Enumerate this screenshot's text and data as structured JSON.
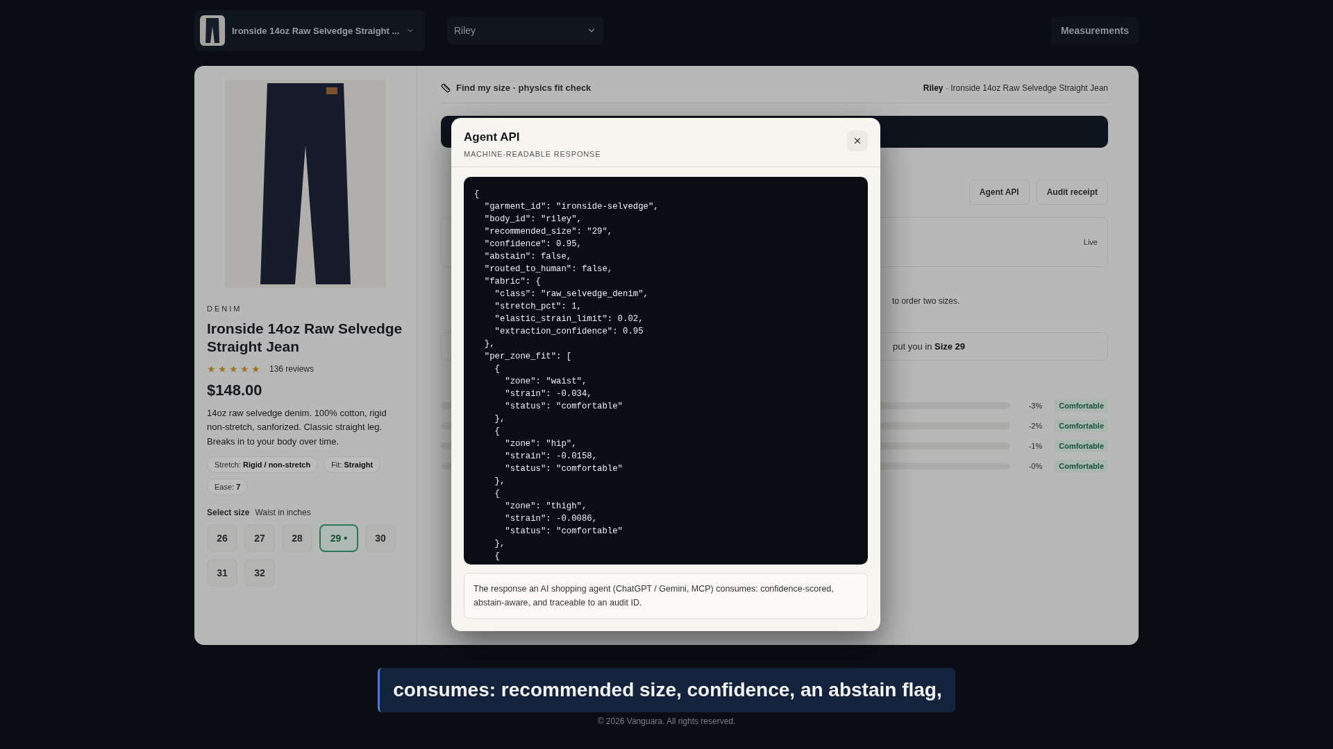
{
  "header": {
    "product_selector": "Ironside 14oz Raw Selvedge Straight ...",
    "body_select": "Riley",
    "measurements_button": "Measurements"
  },
  "product": {
    "category": "DENIM",
    "title": "Ironside 14oz Raw Selvedge Straight Jean",
    "stars": 5,
    "reviews": "136 reviews",
    "price": "$148.00",
    "description": "14oz raw selvedge denim. 100% cotton, rigid non-stretch, sanforized. Classic straight leg. Breaks in to your body over time.",
    "chips": [
      {
        "label": "Stretch:",
        "value": "Rigid / non-stretch"
      },
      {
        "label": "Fit:",
        "value": "Straight"
      },
      {
        "label": "Ease:",
        "value": "7"
      }
    ],
    "size_label": "Select size",
    "size_hint": "Waist in inches",
    "sizes": [
      {
        "label": "26",
        "selected": false
      },
      {
        "label": "27",
        "selected": false
      },
      {
        "label": "28",
        "selected": false
      },
      {
        "label": "29 •",
        "selected": true
      },
      {
        "label": "30",
        "selected": false
      },
      {
        "label": "31",
        "selected": false
      },
      {
        "label": "32",
        "selected": false
      }
    ]
  },
  "fit_panel": {
    "title": "Find my size · physics fit check",
    "breadcrumb": "**Riley** · Ironside 14oz Raw Selvedge Straight Jean",
    "buttons": [
      "Agent API",
      "Audit receipt"
    ],
    "tag": "Live",
    "note_fragment": "to order two sizes.",
    "result_fragment": "put you in **Size 29**",
    "zones": [
      {
        "reading": "-3%",
        "status": "Comfortable"
      },
      {
        "reading": "-2%",
        "status": "Comfortable"
      },
      {
        "reading": "-1%",
        "status": "Comfortable"
      },
      {
        "reading": "-0%",
        "status": "Comfortable"
      }
    ]
  },
  "modal": {
    "title": "Agent API",
    "subtitle": "MACHINE-READABLE RESPONSE",
    "code_lines": [
      "{",
      "  \"garment_id\": \"ironside-selvedge\",",
      "  \"body_id\": \"riley\",",
      "  \"recommended_size\": \"29\",",
      "  \"confidence\": 0.95,",
      "  \"abstain\": false,",
      "  \"routed_to_human\": false,",
      "  \"fabric\": {",
      "    \"class\": \"raw_selvedge_denim\",",
      "    \"stretch_pct\": 1,",
      "    \"elastic_strain_limit\": 0.02,",
      "    \"extraction_confidence\": 0.95",
      "  },",
      "  \"per_zone_fit\": [",
      "    {",
      "      \"zone\": \"waist\",",
      "      \"strain\": -0.034,",
      "      \"status\": \"comfortable\"",
      "    },",
      "    {",
      "      \"zone\": \"hip\",",
      "      \"strain\": -0.0158,",
      "      \"status\": \"comfortable\"",
      "    },",
      "    {",
      "      \"zone\": \"thigh\",",
      "      \"strain\": -0.0086,",
      "      \"status\": \"comfortable\"",
      "    },",
      "    {"
    ],
    "note": "The response an AI shopping agent (ChatGPT / Gemini, MCP) consumes: confidence-scored, abstain-aware, and traceable to an audit ID."
  },
  "caption": "consumes: recommended size, confidence, an abstain flag,",
  "footer": "© 2026 Vanguara. All rights reserved."
}
